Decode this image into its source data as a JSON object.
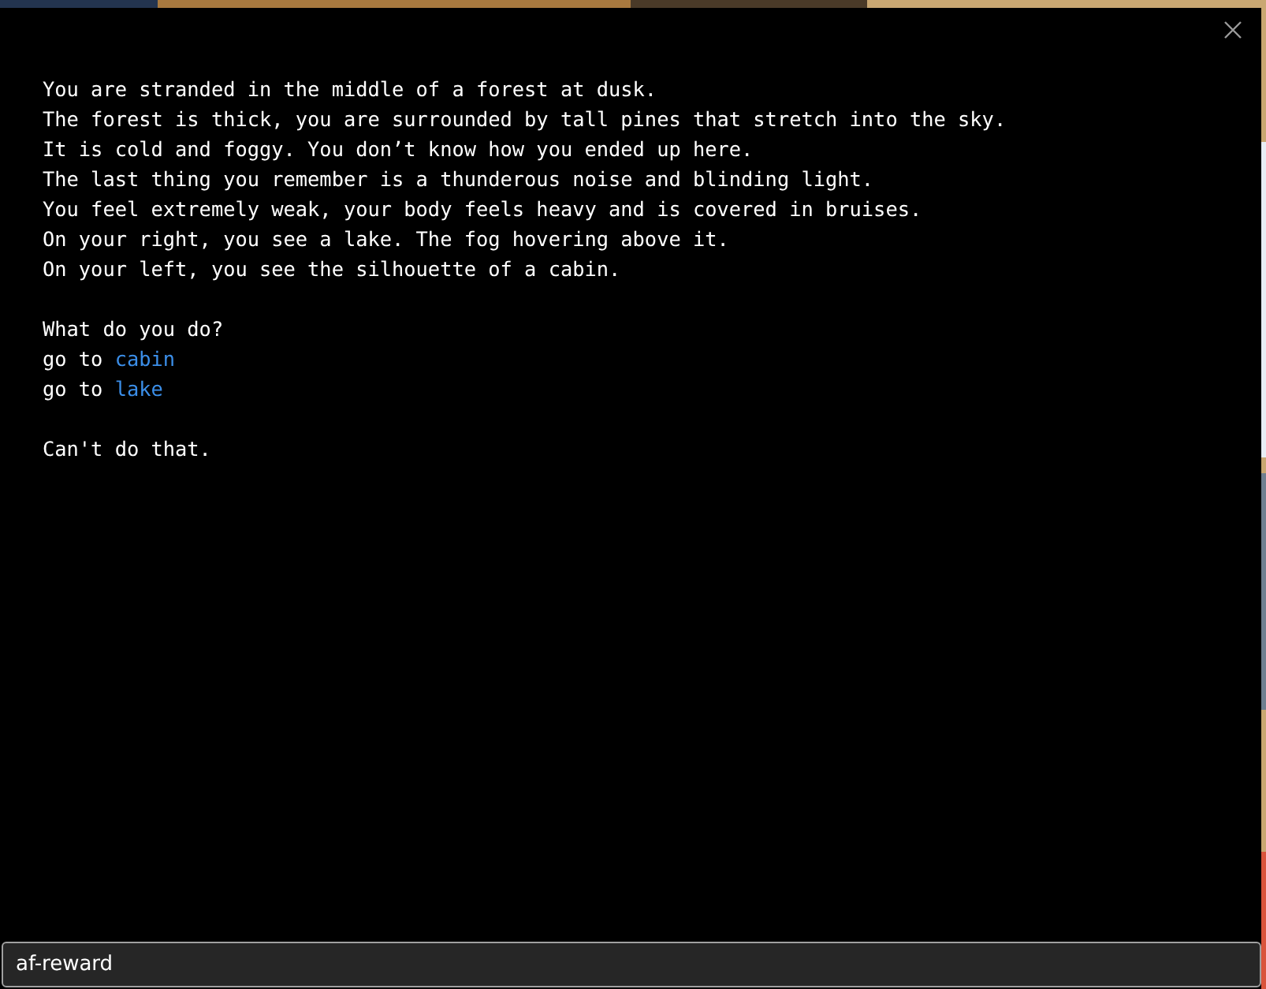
{
  "blocks": [
    {
      "lines": [
        {
          "text": "You are stranded in the middle of a forest at dusk."
        },
        {
          "text": "The forest is thick, you are surrounded by tall pines that stretch into the sky."
        },
        {
          "text": "It is cold and foggy. You don’t know how you ended up here."
        },
        {
          "text": "The last thing you remember is a thunderous noise and blinding light."
        },
        {
          "text": "You feel extremely weak, your body feels heavy and is covered in bruises."
        },
        {
          "text": "On your right, you see a lake. The fog hovering above it."
        },
        {
          "text": "On your left, you see the silhouette of a cabin."
        }
      ]
    },
    {
      "lines": [
        {
          "text": "What do you do?"
        },
        {
          "text": "go to",
          "link": "cabin"
        },
        {
          "text": "go to",
          "link": "lake"
        }
      ]
    },
    {
      "lines": [
        {
          "text": "Can't do that."
        }
      ]
    }
  ],
  "input": {
    "value": "af-reward",
    "focused": true
  }
}
